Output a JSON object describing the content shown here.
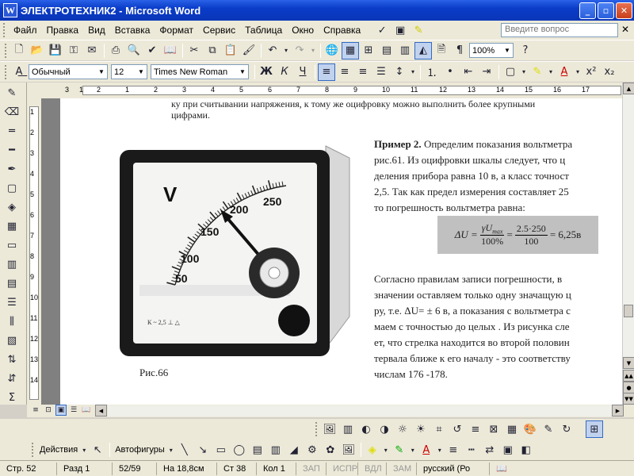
{
  "window": {
    "title": "ЭЛЕКТРОТЕХНИК2 - Microsoft Word"
  },
  "menu": {
    "items": [
      "Файл",
      "Правка",
      "Вид",
      "Вставка",
      "Формат",
      "Сервис",
      "Таблица",
      "Окно",
      "Справка"
    ],
    "ask_placeholder": "Введите вопрос"
  },
  "toolbar": {
    "zoom": "100%"
  },
  "format_toolbar": {
    "style": "Обычный",
    "size": "12",
    "font": "Times New Roman",
    "bold": "Ж",
    "italic": "К",
    "underline": "Ч"
  },
  "ruler": {
    "h_numbers": [
      "3",
      "1",
      "2",
      "1",
      "2",
      "3",
      "4",
      "5",
      "6",
      "7",
      "8",
      "9",
      "10",
      "11",
      "12",
      "13",
      "14",
      "15",
      "16",
      "17"
    ],
    "v_numbers": [
      "1",
      "2",
      "3",
      "4",
      "5",
      "6",
      "7",
      "8",
      "9",
      "10",
      "11",
      "12",
      "13",
      "14"
    ]
  },
  "document": {
    "top_line1": "ку при считывании напряжения, к тому же оцифровку можно выполнить более крупными",
    "top_line2": "цифрами.",
    "example_title": "Пример 2.",
    "example_lines": [
      "Определим показания вольтметра",
      "рис.61.   Из оцифровки шкалы следует, что ц",
      "деления прибора равна 10 в, а класс точност",
      "2,5. Так как предел измерения составляет 25",
      "то погрешность вольтметра равна:"
    ],
    "formula": {
      "lhs": "ΔU =",
      "frac1_num": "γU",
      "frac1_sub": "max",
      "frac1_den": "100%",
      "frac2_num": "2.5·250",
      "frac2_den": "100",
      "result": "= 6,25в"
    },
    "body_lines": [
      "Согласно правилам записи погрешности, в",
      "значении оставляем только одну значащую ц",
      "ру, т.е. ΔU= ± 6 в, а показания с вольтметра с",
      "маем с точностью до целых . Из рисунка сле",
      "ет, что стрелка находится во второй половин",
      "тервала ближе к его началу - это соответству",
      "числам 176 -178."
    ],
    "figure_caption": "Рис.66",
    "meter": {
      "unit": "V",
      "scale": [
        "50",
        "100",
        "150",
        "200",
        "250"
      ],
      "plate": "К ~ 2,5 ⊥ △"
    }
  },
  "drawing_toolbar": {
    "actions": "Действия",
    "autoshapes": "Автофигуры"
  },
  "status": {
    "page": "Стр.  52",
    "section": "Разд  1",
    "pages": "52/59",
    "at": "На 18,8см",
    "line": "Ст  38",
    "col": "Кол  1",
    "rec": "ЗАП",
    "trk": "ИСПР",
    "ext": "ВДЛ",
    "ovr": "ЗАМ",
    "lang": "русский (Ро"
  },
  "colors": {
    "titlebar": "#0a3cc8",
    "formula_bg": "#c0c0c0",
    "toolbar_bg": "#ece9d8"
  }
}
